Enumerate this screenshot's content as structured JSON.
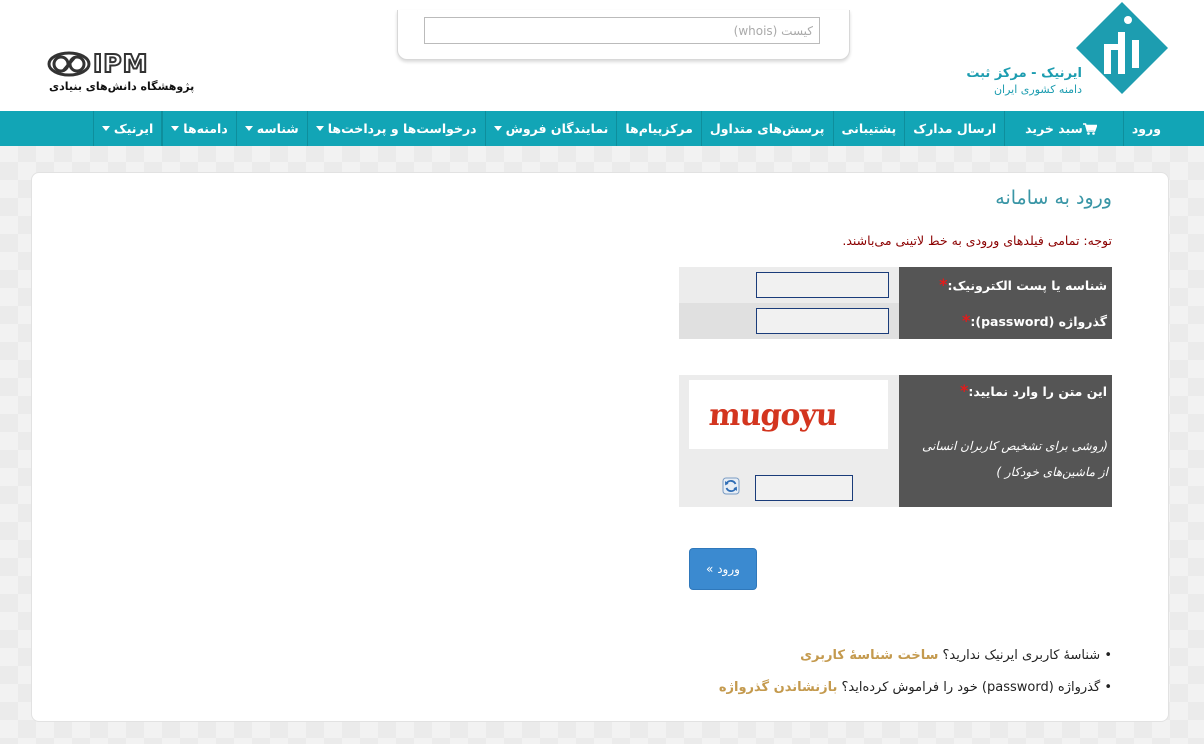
{
  "header": {
    "brand_name": "ایرنیک - مرکز ثبت",
    "brand_sub": "دامنه کشوری ایران",
    "ipm_logo_text": "IPM",
    "ipm_subtitle": "پژوهشگاه دانش‌های بنیادی",
    "search": {
      "placeholder": "کیست (whois)",
      "value": ""
    },
    "brand_color": "#1d9db0"
  },
  "nav": {
    "bar_color": "#12a5b6",
    "items": [
      {
        "label": "ایرنیک",
        "dropdown": true
      },
      {
        "label": "دامنه‌ها",
        "dropdown": true
      },
      {
        "label": "شناسه",
        "dropdown": true
      },
      {
        "label": "درخواست‌ها و پرداخت‌ها",
        "dropdown": true
      },
      {
        "label": "نمایندگان فروش",
        "dropdown": true
      },
      {
        "label": "مرکزپیام‌ها",
        "dropdown": false
      },
      {
        "label": "پرسش‌های متداول",
        "dropdown": false
      },
      {
        "label": "پشتیبانی",
        "dropdown": false
      },
      {
        "label": "ارسال مدارک",
        "dropdown": false
      },
      {
        "label": "سبد خرید",
        "icon": "cart-icon"
      },
      {
        "label": "ورود",
        "dropdown": false
      }
    ]
  },
  "login": {
    "title": "ورود به سامانه",
    "notice": "توجه: تمامی فیلدهای ورودی به خط لاتینی می‌باشند.",
    "required_mark": "*",
    "username_label": "شناسه یا پست الکترونیک:",
    "username_value": "",
    "password_label": "گذرواژه (password):",
    "password_value": "",
    "captcha_label": "این متن را وارد نمایید:",
    "captcha_help_line1": "(روشی برای تشخیص کاربران انسانی",
    "captcha_help_line2": "از ماشین‌های خودکار )",
    "captcha_text": "mugoyu",
    "captcha_value": "",
    "submit_label": "ورود »"
  },
  "links": {
    "signup_prefix": "• شناسهٔ کاربری ایرنیک ندارید؟",
    "signup_link": "ساخت شناسهٔ کاربری",
    "reset_prefix": "• گذرواژه (password) خود را فراموش کرده‌اید؟",
    "reset_link": "بازنشاندن گذرواژه"
  }
}
